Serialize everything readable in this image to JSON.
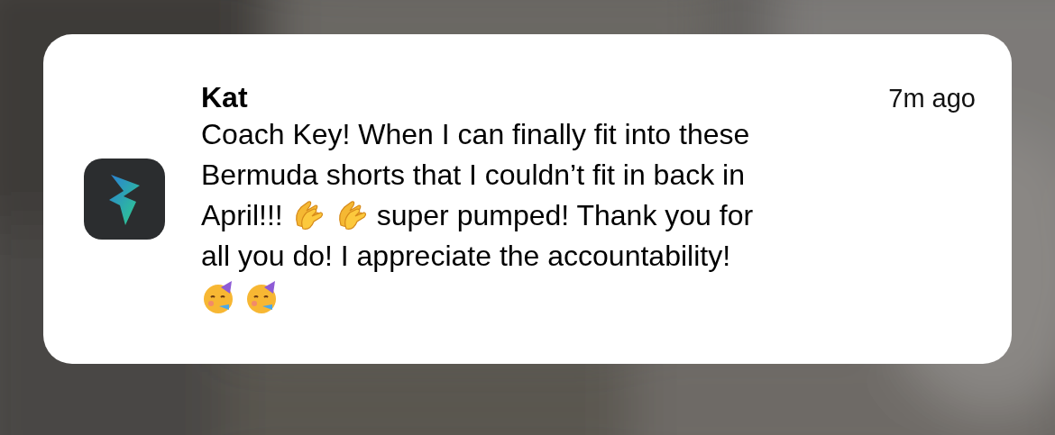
{
  "notification": {
    "sender": "Kat",
    "time": "7m ago",
    "lines": [
      [
        {
          "kind": "text",
          "text": "Coach Key! When I can finally fit into these"
        }
      ],
      [
        {
          "kind": "text",
          "text": "Bermuda shorts that I couldn’t fit in back in"
        }
      ],
      [
        {
          "kind": "text",
          "text": "April!!!"
        },
        {
          "kind": "clap"
        },
        {
          "kind": "clap"
        },
        {
          "kind": "text",
          "text": "super pumped! Thank you for"
        }
      ],
      [
        {
          "kind": "text",
          "text": "all you do! I appreciate the accountability!"
        }
      ],
      [
        {
          "kind": "party"
        },
        {
          "kind": "party"
        }
      ]
    ]
  }
}
